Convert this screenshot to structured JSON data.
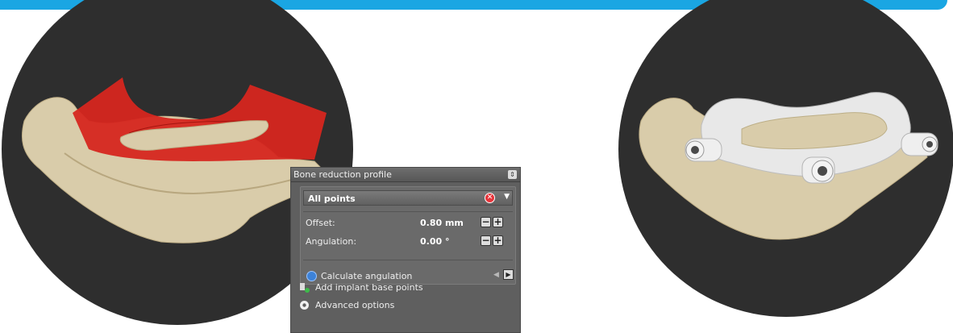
{
  "panel": {
    "title": "Bone reduction profile",
    "selection": {
      "label": "All points",
      "clear_icon": "clear-icon",
      "dropdown_icon": "dropdown-arrow-icon"
    },
    "offset": {
      "label": "Offset:",
      "value": "0.80 mm"
    },
    "angulation": {
      "label": "Angulation:",
      "value": "0.00 °"
    },
    "calculate": {
      "label": "Calculate angulation",
      "icon": "angle-icon"
    },
    "add_points": {
      "label": "Add implant base points",
      "icon": "implant-add-icon"
    },
    "advanced": {
      "label": "Advanced options",
      "icon": "gear-icon"
    },
    "stepper_minus": "−",
    "stepper_plus": "+"
  },
  "colors": {
    "accent_bar": "#1aa6e3",
    "panel_bg": "#5f5f5f",
    "reduction_surface": "#d6261f",
    "bone": "#d9ccaa",
    "guide": "#e8e8e8",
    "scene_bg": "#2e2e2e"
  }
}
